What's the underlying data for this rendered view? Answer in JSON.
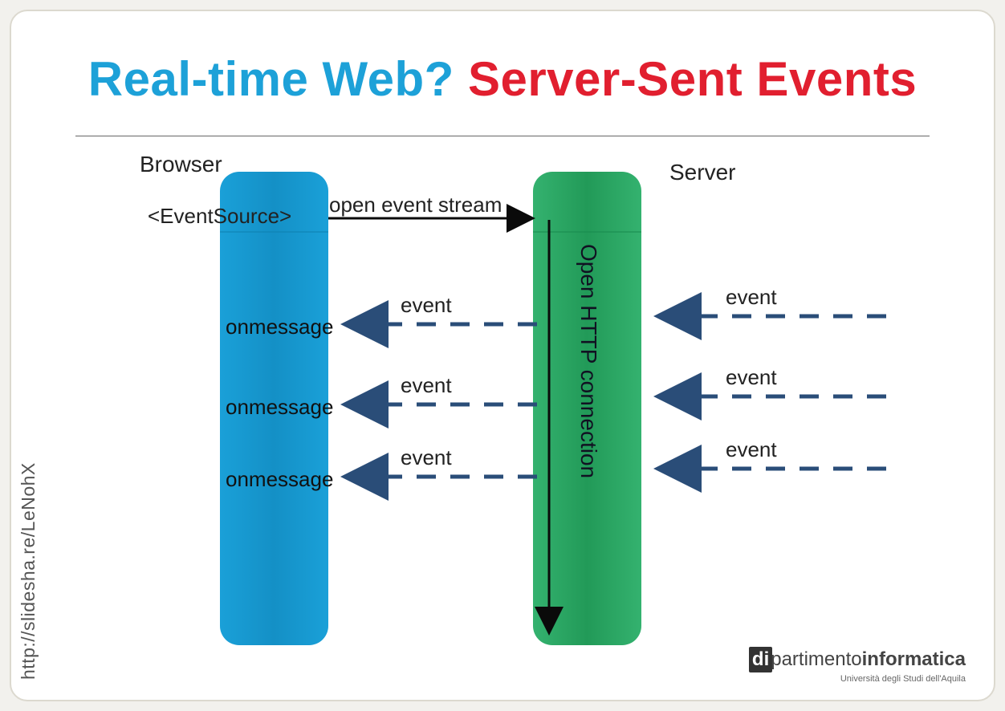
{
  "title": {
    "part1": "Real-time Web? ",
    "part2": "Server-Sent Events"
  },
  "diagram": {
    "browser_label": "Browser",
    "server_label": "Server",
    "event_source_label": "<EventSource>",
    "open_stream_label": "open event stream",
    "open_http_label": "Open HTTP connection",
    "events": {
      "incoming_label": "event",
      "onmessage_label": "onmessage"
    }
  },
  "side_url": "http://slidesha.re/LeNohX",
  "footer": {
    "logo_prefix": "di",
    "logo_mid": "partimento",
    "logo_bold": "informatica",
    "logo_sub": "Università degli Studi dell'Aquila"
  },
  "colors": {
    "title_blue": "#1da1d8",
    "title_red": "#e11f2f",
    "browser_fill": "#1597ce",
    "server_fill": "#2aa563",
    "arrow_dark": "#0a0a0a",
    "dash_blue": "#2a4d78"
  }
}
